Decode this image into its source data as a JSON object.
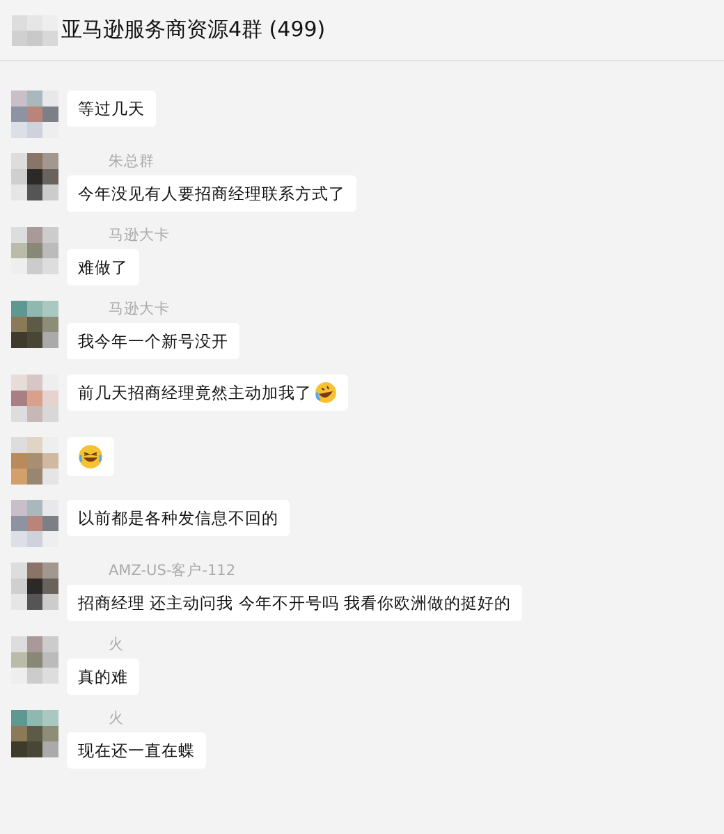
{
  "header": {
    "title": "亚马逊服务商资源4群 (499)"
  },
  "messages": [
    {
      "text": "等过几天"
    },
    {
      "sender": "朱总群",
      "text": "今年没见有人要招商经理联系方式了"
    },
    {
      "sender": "马逊大卡",
      "text": "难做了"
    },
    {
      "sender": "马逊大卡",
      "text": "我今年一个新号没开"
    },
    {
      "text": "前几天招商经理竟然主动加我了",
      "emoji": {
        "kind": "rolling"
      }
    },
    {
      "emoji": {
        "kind": "laughing"
      }
    },
    {
      "text": "以前都是各种发信息不回的"
    },
    {
      "sender": "AMZ-US-客户-112",
      "text": "招商经理 还主动问我 今年不开号吗 我看你欧洲做的挺好的"
    },
    {
      "sender": "火",
      "text": "真的难"
    },
    {
      "sender": "火",
      "text": "现在还一直在蝶"
    }
  ]
}
